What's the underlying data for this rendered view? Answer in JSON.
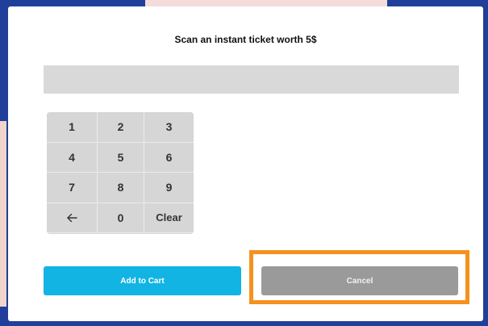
{
  "dialog": {
    "title": "Scan an instant ticket worth 5$",
    "scan_value": "",
    "scan_placeholder": ""
  },
  "keypad": {
    "keys": [
      "1",
      "2",
      "3",
      "4",
      "5",
      "6",
      "7",
      "8",
      "9",
      "",
      "0",
      "Clear"
    ],
    "back_icon": "arrow-left-icon"
  },
  "actions": {
    "add_label": "Add to Cart",
    "cancel_label": "Cancel"
  },
  "colors": {
    "accent": "#11b4e3",
    "highlight": "#f5911e",
    "cancel": "#9a9a9a",
    "backdrop": "#1f3f9a"
  }
}
